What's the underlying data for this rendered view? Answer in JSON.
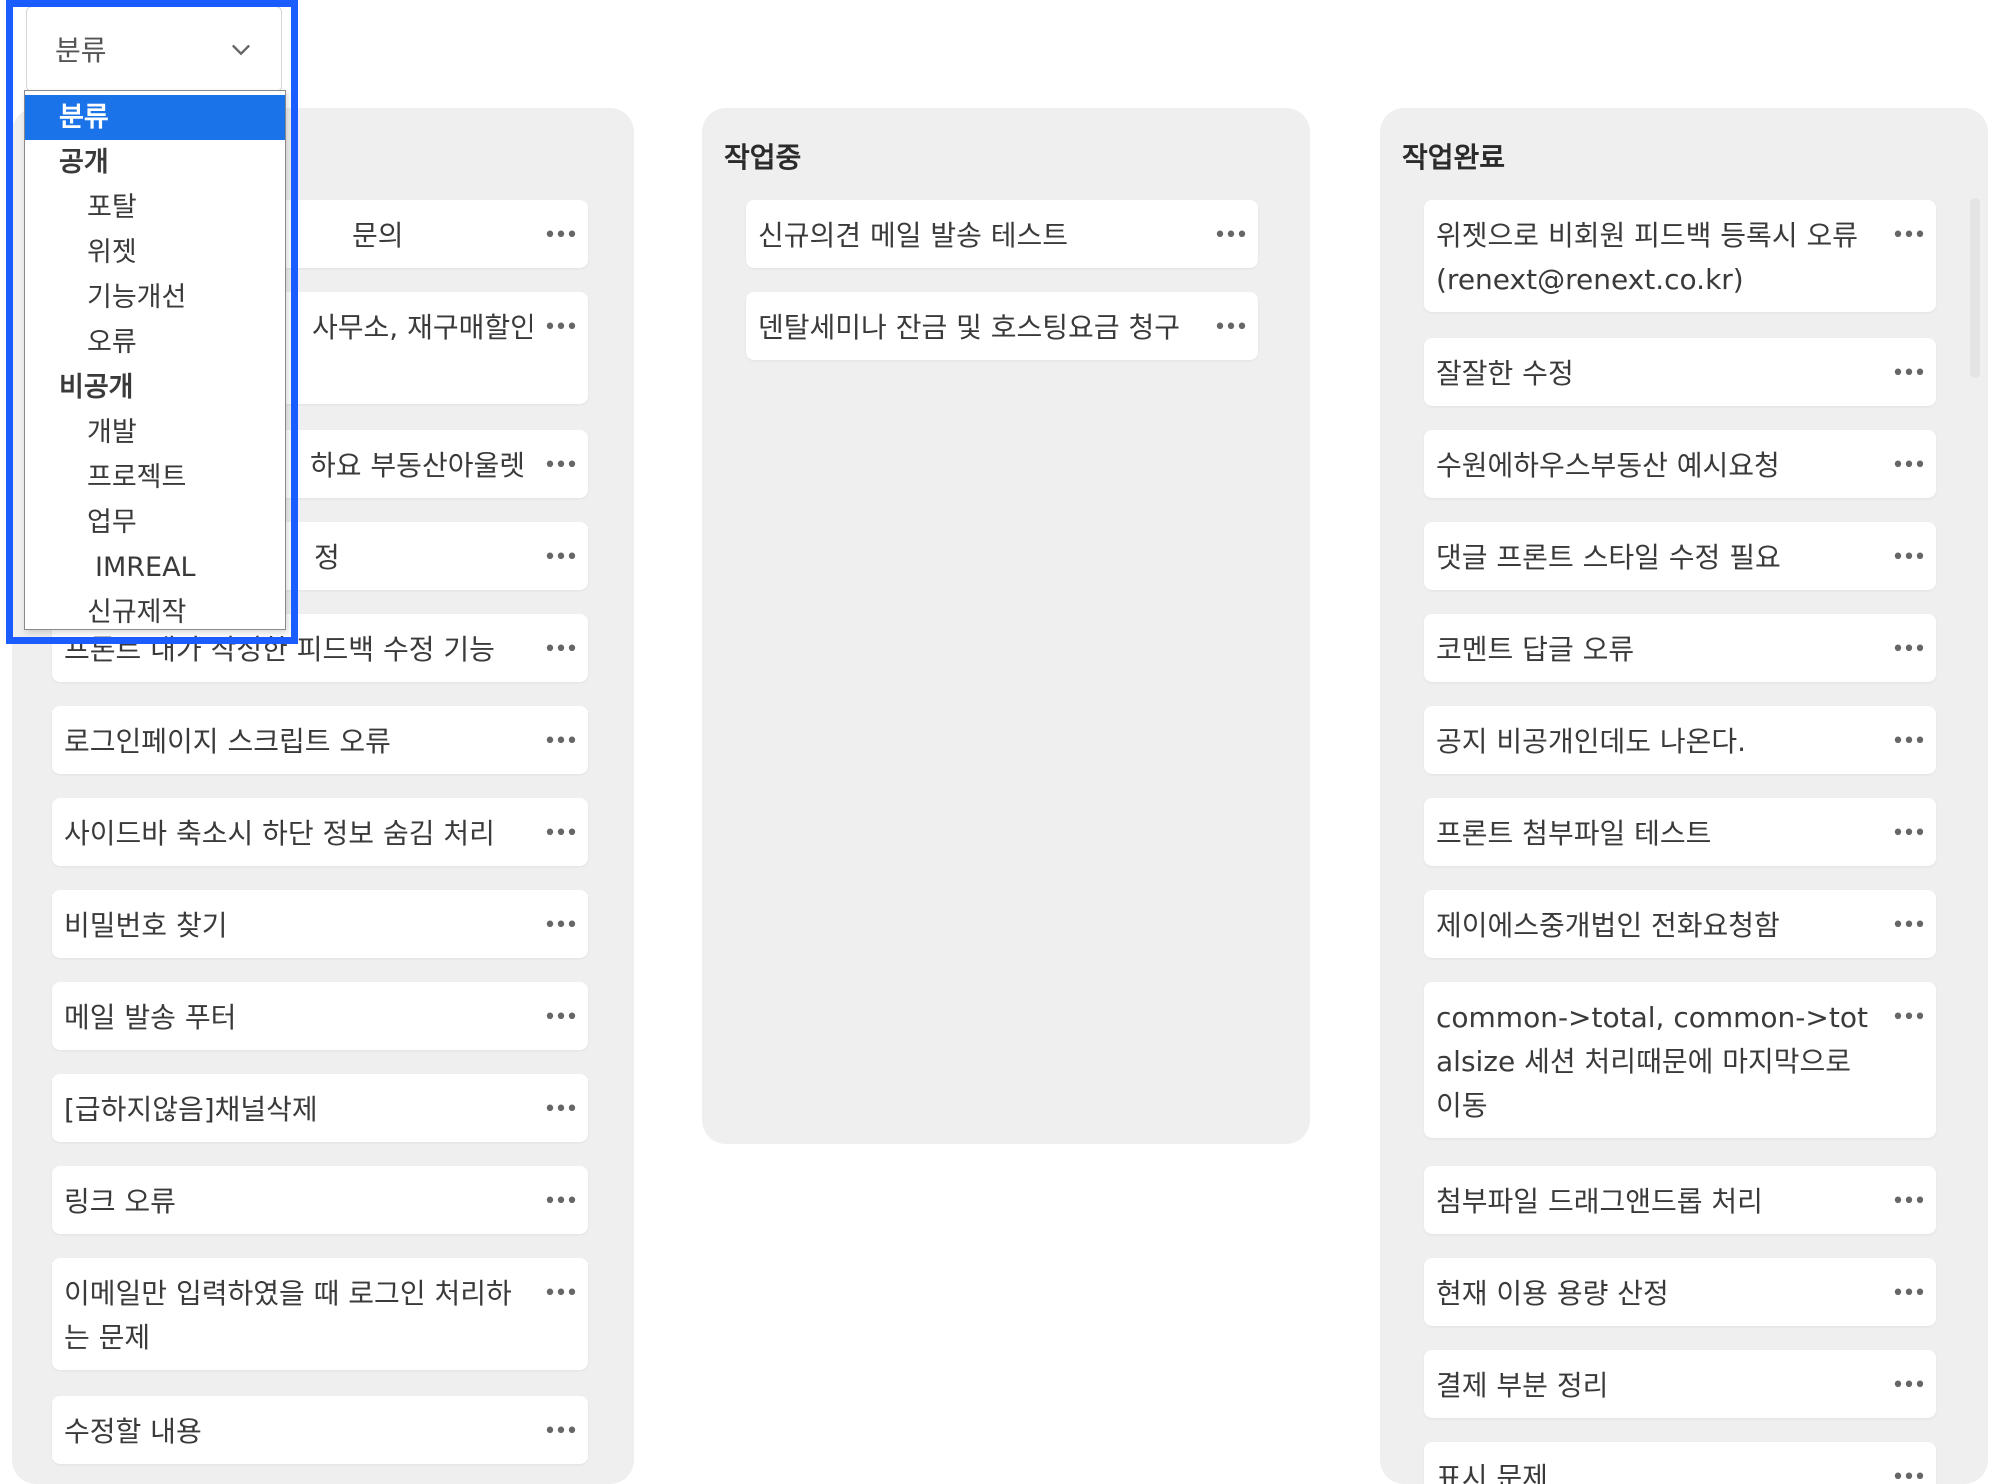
{
  "filter": {
    "selected_label": "분류",
    "options": [
      {
        "label": "분류",
        "level": "header",
        "selected": true
      },
      {
        "label": "공개",
        "level": "group"
      },
      {
        "label": "포탈",
        "level": "child"
      },
      {
        "label": "위젯",
        "level": "child"
      },
      {
        "label": "기능개선",
        "level": "child"
      },
      {
        "label": "오류",
        "level": "child"
      },
      {
        "label": "비공개",
        "level": "group"
      },
      {
        "label": "개발",
        "level": "child"
      },
      {
        "label": "프로젝트",
        "level": "child"
      },
      {
        "label": "업무",
        "level": "child"
      },
      {
        "label": "IMREAL",
        "level": "child"
      },
      {
        "label": "신규제작",
        "level": "child"
      }
    ],
    "highlight_color": "#1a5cff"
  },
  "columns": [
    {
      "title": "",
      "cards": [
        {
          "text": "문의"
        },
        {
          "text": "사무소, 재구매할인,"
        },
        {
          "text": "하요 부동산아울렛"
        },
        {
          "text": "정"
        },
        {
          "text": "프론트 내가 작성한 피드백 수정 기능"
        },
        {
          "text": "로그인페이지 스크립트 오류"
        },
        {
          "text": "사이드바 축소시 하단 정보 숨김 처리"
        },
        {
          "text": "비밀번호 찾기"
        },
        {
          "text": "메일 발송 푸터"
        },
        {
          "text": "[급하지않음]채널삭제"
        },
        {
          "text": "링크 오류"
        },
        {
          "text": "이메일만 입력하였을 때 로그인 처리하는 문제"
        },
        {
          "text": "수정할 내용"
        }
      ]
    },
    {
      "title": "작업중",
      "cards": [
        {
          "text": "신규의견 메일 발송 테스트"
        },
        {
          "text": "덴탈세미나 잔금 및 호스팅요금 청구"
        }
      ]
    },
    {
      "title": "작업완료",
      "cards": [
        {
          "text": "위젯으로 비회원 피드백 등록시 오류 (renext@renext.co.kr)"
        },
        {
          "text": "잘잘한 수정"
        },
        {
          "text": "수원에하우스부동산 예시요청"
        },
        {
          "text": "댓글 프론트 스타일 수정 필요"
        },
        {
          "text": "코멘트 답글 오류"
        },
        {
          "text": "공지 비공개인데도 나온다."
        },
        {
          "text": "프론트 첨부파일 테스트"
        },
        {
          "text": "제이에스중개법인 전화요청함"
        },
        {
          "text": "common->total, common->totalsize 세션 처리때문에 마지막으로 이동"
        },
        {
          "text": "첨부파일 드래그앤드롭 처리"
        },
        {
          "text": "현재 이용 용량 산정"
        },
        {
          "text": "결제 부분 정리"
        },
        {
          "text": "표시 문제"
        }
      ]
    }
  ],
  "more_glyph": "•••",
  "icons": {
    "dropdown": "chevron-down-icon",
    "card_menu": "more-horizontal-icon"
  },
  "colors": {
    "column_bg": "#efefef",
    "card_bg": "#ffffff",
    "selected_option": "#1a73e8"
  }
}
